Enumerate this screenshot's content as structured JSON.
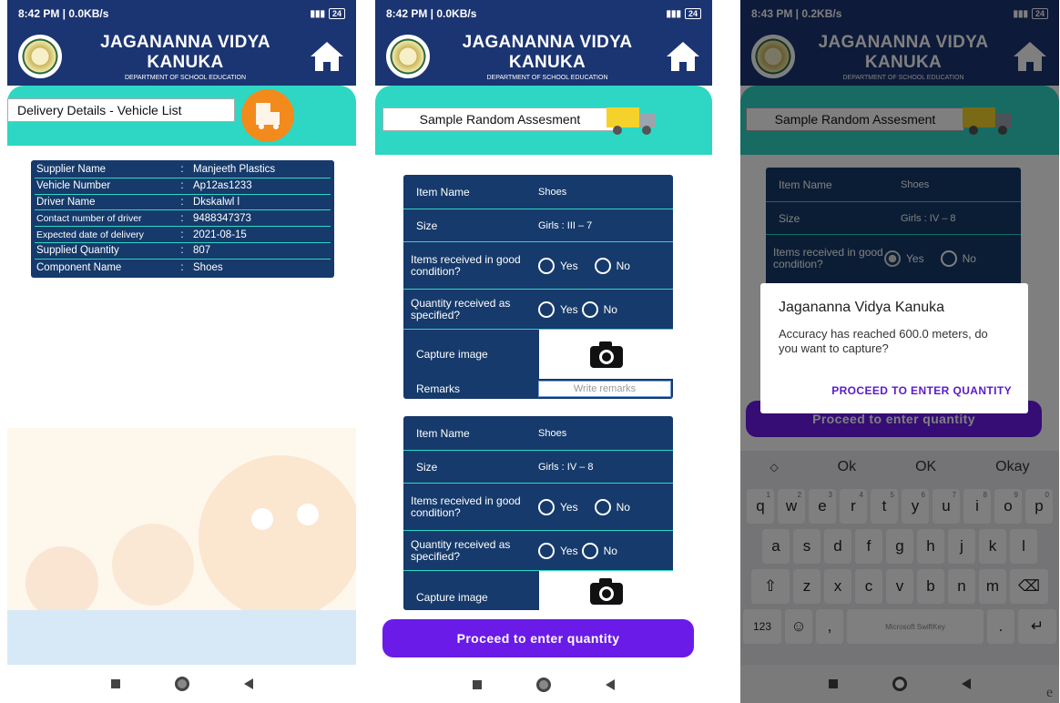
{
  "screen1": {
    "status": {
      "time": "8:42 PM | 0.0KB/s",
      "battery": "24"
    },
    "header": {
      "title": "JAGANANNA VIDYA KANUKA",
      "subtitle": "DEPARTMENT OF SCHOOL EDUCATION"
    },
    "banner_label": "Delivery Details - Vehicle List",
    "details": [
      {
        "key": "Supplier Name",
        "value": "Manjeeth Plastics"
      },
      {
        "key": "Vehicle Number",
        "value": "Ap12as1233"
      },
      {
        "key": "Driver Name",
        "value": "Dkskalwl l"
      },
      {
        "key": "Contact number of driver",
        "value": "9488347373"
      },
      {
        "key": "Expected date of delivery",
        "value": "2021-08-15"
      },
      {
        "key": "Supplied Quantity",
        "value": "807"
      },
      {
        "key": "Component Name",
        "value": "Shoes"
      }
    ],
    "separator": ":"
  },
  "screen2": {
    "status": {
      "time": "8:42 PM | 0.0KB/s",
      "battery": "24"
    },
    "header": {
      "title": "JAGANANNA VIDYA KANUKA",
      "subtitle": "DEPARTMENT OF SCHOOL EDUCATION"
    },
    "banner_label": "Sample Random Assesment",
    "labels": {
      "item_name": "Item Name",
      "size": "Size",
      "good_condition": "Items received in good condition?",
      "quantity_specified": "Quantity received as specified?",
      "capture": "Capture image",
      "remarks": "Remarks",
      "yes": "Yes",
      "no": "No",
      "remarks_placeholder": "Write remarks"
    },
    "cards": [
      {
        "item": "Shoes",
        "size": "Girls : III – 7"
      },
      {
        "item": "Shoes",
        "size": "Girls : IV – 8"
      }
    ],
    "proceed": "Proceed to enter quantity"
  },
  "screen3": {
    "status": {
      "time": "8:43 PM | 0.2KB/s",
      "battery": "24"
    },
    "header": {
      "title": "JAGANANNA VIDYA KANUKA",
      "subtitle": "DEPARTMENT OF SCHOOL EDUCATION"
    },
    "banner_label": "Sample Random Assesment",
    "card": {
      "item_label": "Item Name",
      "item": "Shoes",
      "size_label": "Size",
      "size": "Girls : IV – 8",
      "good_condition": "Items received in good condition?",
      "yes": "Yes",
      "no": "No"
    },
    "proceed": "Proceed to enter quantity",
    "dialog": {
      "title": "Jagananna Vidya Kanuka",
      "message": "Accuracy has reached 600.0 meters, do you want to capture?",
      "button": "PROCEED TO ENTER QUANTITY"
    },
    "keyboard": {
      "suggestions": [
        "Ok",
        "OK",
        "Okay"
      ],
      "row1": [
        "q",
        "w",
        "e",
        "r",
        "t",
        "y",
        "u",
        "i",
        "o",
        "p"
      ],
      "row1_sub": [
        "1",
        "2",
        "3",
        "4",
        "5",
        "6",
        "7",
        "8",
        "9",
        "0"
      ],
      "row2": [
        "a",
        "s",
        "d",
        "f",
        "g",
        "h",
        "j",
        "k",
        "l"
      ],
      "row3": [
        "z",
        "x",
        "c",
        "v",
        "b",
        "n",
        "m"
      ],
      "numbers_key": "123",
      "comma": ",",
      "period": ".",
      "space_label": "Microsoft SwiftKey"
    }
  },
  "stray_char": "e"
}
